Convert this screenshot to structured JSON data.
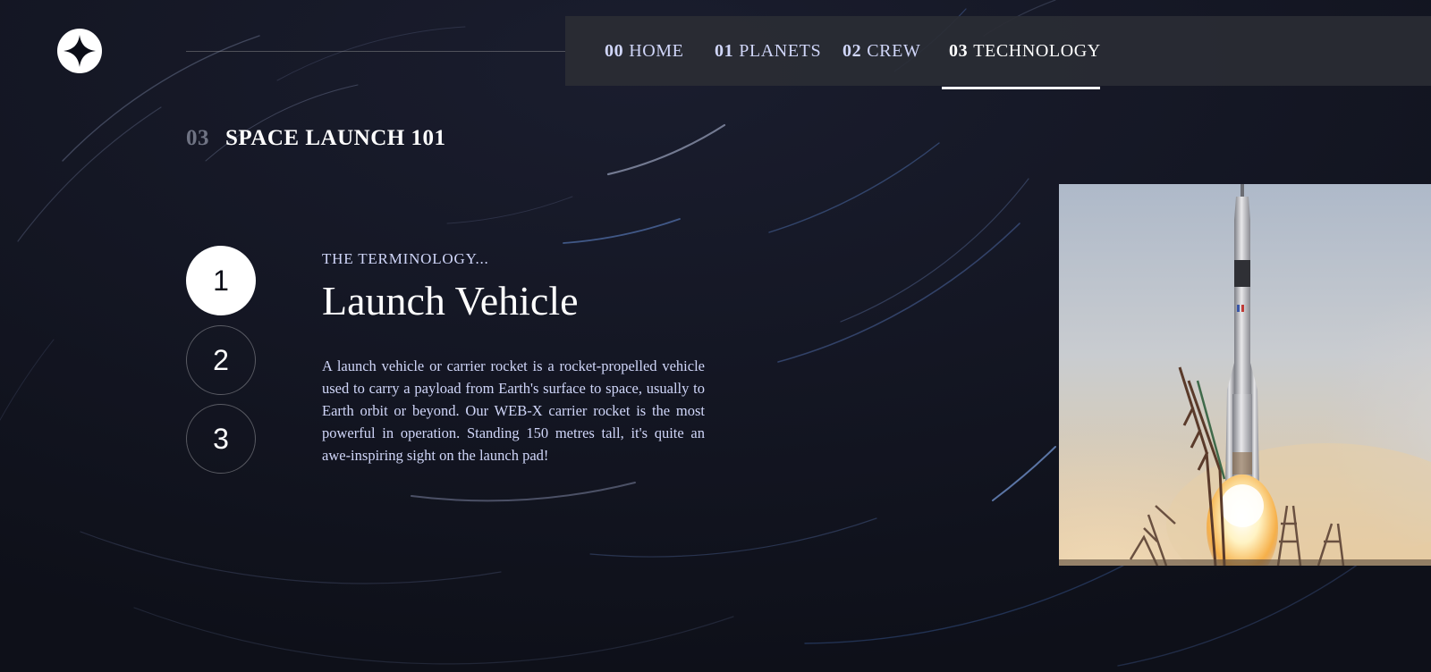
{
  "header": {
    "logo_icon": "star-logo-icon"
  },
  "nav": {
    "items": [
      {
        "num": "00",
        "label": "HOME"
      },
      {
        "num": "01",
        "label": "PLANETS"
      },
      {
        "num": "02",
        "label": "CREW"
      },
      {
        "num": "03",
        "label": "TECHNOLOGY"
      }
    ],
    "active_index": 3
  },
  "page": {
    "num": "03",
    "title": "SPACE LAUNCH 101"
  },
  "steps": [
    {
      "label": "1"
    },
    {
      "label": "2"
    },
    {
      "label": "3"
    }
  ],
  "active_step": 1,
  "content": {
    "kicker": "THE TERMINOLOGY...",
    "title": "Launch Vehicle",
    "description": "A launch vehicle or carrier rocket is a rocket-propelled vehicle used to carry a payload from Earth's surface to space, usually to Earth orbit or beyond. Our WEB-X carrier rocket is the most powerful in operation. Standing 150 metres tall, it's quite an awe-inspiring sight on the launch pad!"
  },
  "image": {
    "subject": "rocket-launch-photo"
  },
  "colors": {
    "background": "#0f111c",
    "nav_bg": "#2a2c34",
    "text_light": "#d0d6f9",
    "white": "#ffffff"
  }
}
